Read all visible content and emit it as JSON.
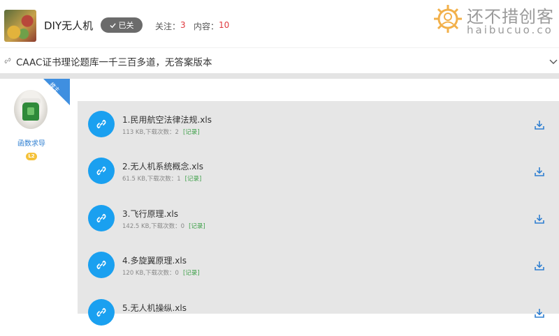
{
  "header": {
    "group_name": "DIY无人机",
    "joined_label": "已关",
    "follow_label": "关注：",
    "follow_count": "3",
    "content_label": "内容：",
    "content_count": "10"
  },
  "watermark": {
    "title": "还不措创客",
    "domain": "haibucuo.co"
  },
  "post": {
    "title": "CAAC证书理论题库一千三百多道，无答案版本"
  },
  "author": {
    "name": "函数求导",
    "level": "L2",
    "ribbon": "楼主"
  },
  "files": [
    {
      "name": "1.民用航空法律法规.xls",
      "meta": "113 KB,下载次数：2",
      "record": "[记录]"
    },
    {
      "name": "2.无人机系统概念.xls",
      "meta": "61.5 KB,下载次数：1",
      "record": "[记录]"
    },
    {
      "name": "3.飞行原理.xls",
      "meta": "142.5 KB,下载次数：0",
      "record": "[记录]"
    },
    {
      "name": "4.多旋翼原理.xls",
      "meta": "120 KB,下载次数：0",
      "record": "[记录]"
    },
    {
      "name": "5.无人机操纵.xls",
      "meta": "",
      "record": ""
    }
  ],
  "colors": {
    "accent_blue": "#1aa0f0",
    "link_blue": "#2f7fd1",
    "count_red": "#e0393e",
    "record_green": "#3fa14a",
    "badge_yellow": "#f5c23a",
    "ribbon_blue": "#3f8fe0"
  },
  "icons": {
    "file": "link-icon",
    "download": "download-icon",
    "joined": "check-icon",
    "expand": "chevron-down-icon"
  }
}
